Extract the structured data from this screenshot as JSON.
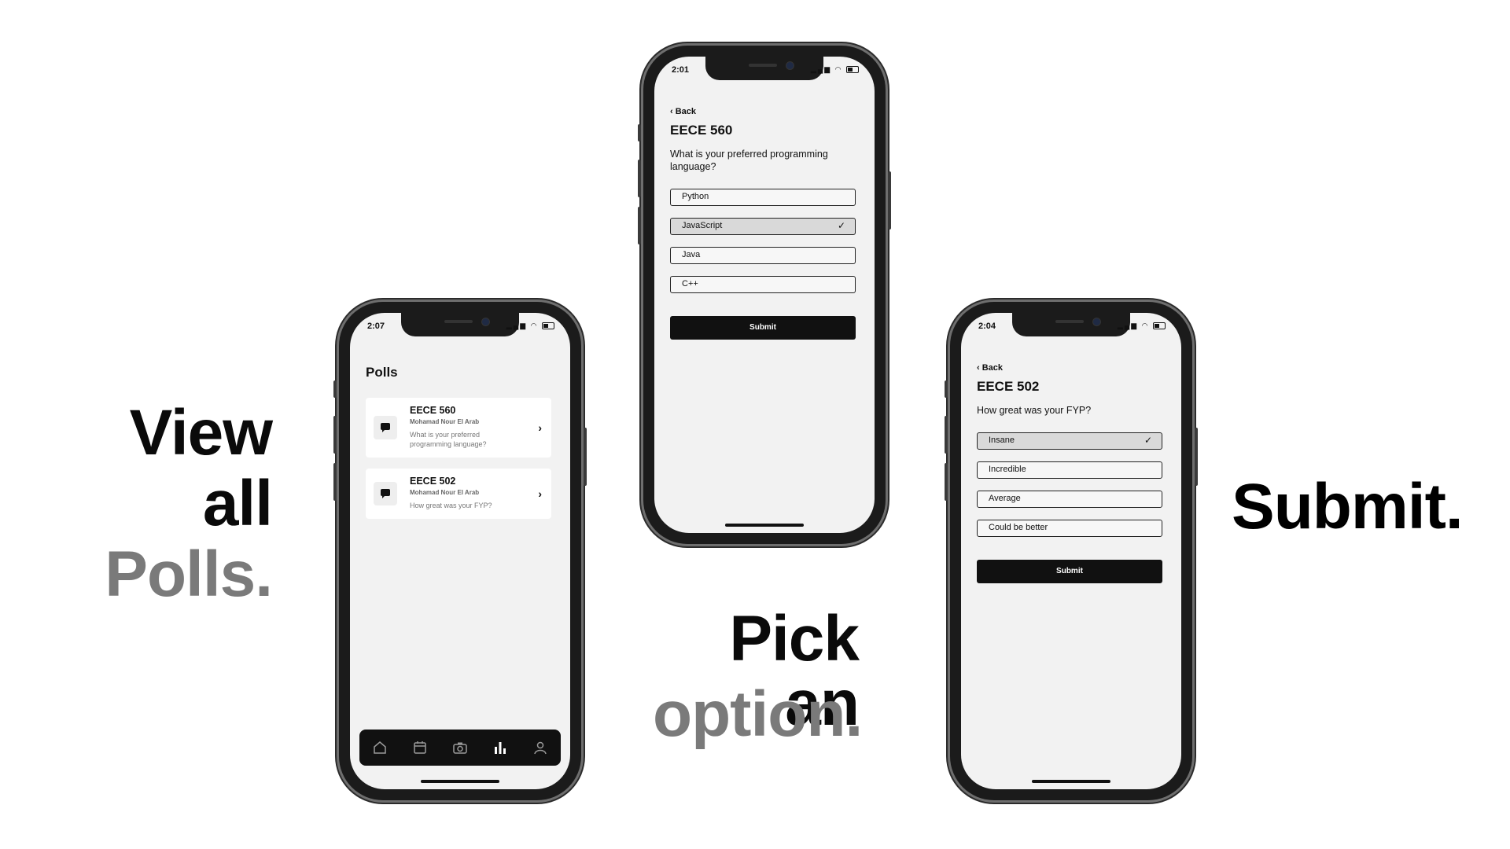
{
  "captions": {
    "view": [
      "View",
      "all",
      "Polls."
    ],
    "pick": [
      "Pick an",
      "option."
    ],
    "submit": "Submit."
  },
  "phone_list": {
    "time": "2:07",
    "title": "Polls",
    "polls": [
      {
        "title": "EECE 560",
        "author": "Mohamad Nour El Arab",
        "question": "What is your preferred programming language?"
      },
      {
        "title": "EECE 502",
        "author": "Mohamad Nour El Arab",
        "question": "How great was your FYP?"
      }
    ],
    "tabs": [
      "home-icon",
      "calendar-icon",
      "camera-icon",
      "polls-icon",
      "profile-icon"
    ],
    "active_tab": "polls-icon"
  },
  "phone_pick": {
    "time": "2:01",
    "back": "Back",
    "title": "EECE 560",
    "question": "What is your preferred programming language?",
    "options": [
      "Python",
      "JavaScript",
      "Java",
      "C++"
    ],
    "selected": "JavaScript",
    "submit": "Submit"
  },
  "phone_submit": {
    "time": "2:04",
    "back": "Back",
    "title": "EECE 502",
    "question": "How great was your FYP?",
    "options": [
      "Insane",
      "Incredible",
      "Average",
      "Could be better"
    ],
    "selected": "Insane",
    "submit": "Submit"
  },
  "colors": {
    "accent": "#111111",
    "caption_gray": "#7a7a7a",
    "screen_bg": "#f2f2f2"
  }
}
